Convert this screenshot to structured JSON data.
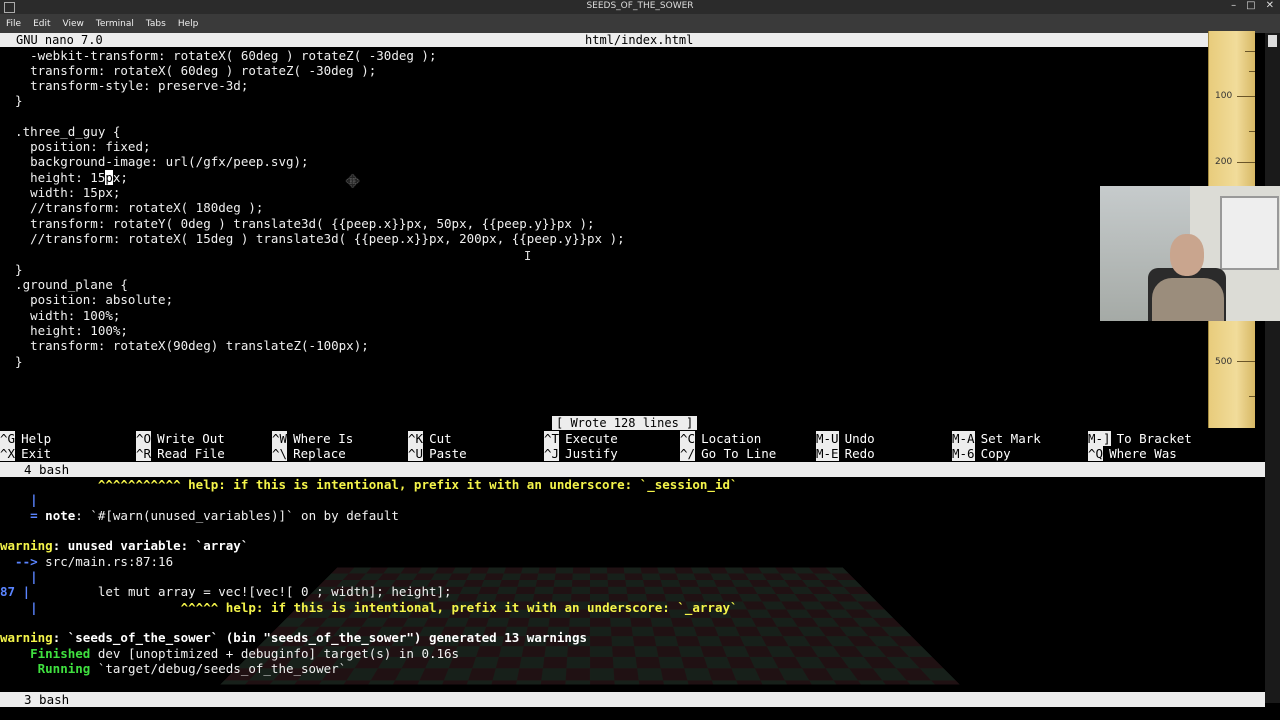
{
  "window": {
    "title": "SEEDS_OF_THE_SOWER",
    "controls": [
      "–",
      "□",
      "✕"
    ]
  },
  "menu": [
    "File",
    "Edit",
    "View",
    "Terminal",
    "Tabs",
    "Help"
  ],
  "nano": {
    "version": "GNU nano 7.0",
    "filename": "html/index.html",
    "status_message": "[ Wrote 128 lines ]",
    "lines": [
      "    -webkit-transform: rotateX( 60deg ) rotateZ( -30deg );",
      "    transform: rotateX( 60deg ) rotateZ( -30deg );",
      "    transform-style: preserve-3d;",
      "  }",
      "",
      "  .three_d_guy {",
      "    position: fixed;",
      "    background-image: url(/gfx/peep.svg);",
      "    height: 15px;",
      "    width: 15px;",
      "    //transform: rotateX( 180deg );",
      "    transform: rotateY( 0deg ) translate3d( {{peep.x}}px, 50px, {{peep.y}}px );",
      "    //transform: rotateX( 15deg ) translate3d( {{peep.x}}px, 200px, {{peep.y}}px );",
      "",
      "  }",
      "  .ground_plane {",
      "    position: absolute;",
      "    width: 100%;",
      "    height: 100%;",
      "    transform: rotateX(90deg) translateZ(-100px);",
      "  }"
    ],
    "shortcuts_row1": [
      {
        "key": "^G",
        "label": "Help"
      },
      {
        "key": "^O",
        "label": "Write Out"
      },
      {
        "key": "^W",
        "label": "Where Is"
      },
      {
        "key": "^K",
        "label": "Cut"
      },
      {
        "key": "^T",
        "label": "Execute"
      },
      {
        "key": "^C",
        "label": "Location"
      },
      {
        "key": "M-U",
        "label": "Undo"
      },
      {
        "key": "M-A",
        "label": "Set Mark"
      },
      {
        "key": "M-]",
        "label": "To Bracket"
      }
    ],
    "shortcuts_row2": [
      {
        "key": "^X",
        "label": "Exit"
      },
      {
        "key": "^R",
        "label": "Read File"
      },
      {
        "key": "^\\",
        "label": "Replace"
      },
      {
        "key": "^U",
        "label": "Paste"
      },
      {
        "key": "^J",
        "label": "Justify"
      },
      {
        "key": "^/",
        "label": "Go To Line"
      },
      {
        "key": "M-E",
        "label": "Redo"
      },
      {
        "key": "M-6",
        "label": "Copy"
      },
      {
        "key": "^Q",
        "label": "Where Was"
      }
    ]
  },
  "panes": {
    "top_label": "4 bash",
    "bottom_label": "3 bash"
  },
  "terminal": {
    "l1_caret": "             ^^^^^^^^^^^",
    "l1_help": " help: if this is intentional, prefix it with an underscore: `_session_id`",
    "l2": "    |",
    "l3_eq": "    =",
    "l3_note": " note",
    "l3_rest": ": `#[warn(unused_variables)]` on by default",
    "l4_warning": "warning",
    "l4_rest": ": unused variable: `array`",
    "l5_arrow": "  -->",
    "l5_path": " src/main.rs:87:16",
    "l6": "    |",
    "l7_num": "87",
    "l7_bar": " |",
    "l7_code": "         let mut array = vec![vec![ 0 ; width]; height];",
    "l8_bar": "    |",
    "l8_caret": "                   ^^^^^",
    "l8_help": " help: if this is intentional, prefix it with an underscore: `_array`",
    "l9_warning": "warning",
    "l9_rest": ": `seeds_of_the_sower` (bin \"seeds_of_the_sower\") generated 13 warnings",
    "l10_finished": "    Finished",
    "l10_rest": " dev [unoptimized + debuginfo] target(s) in 0.16s",
    "l11_running": "     Running",
    "l11_rest": " `target/debug/seeds_of_the_sower`"
  },
  "ruler": {
    "marks": [
      "100",
      "200",
      "500"
    ]
  }
}
